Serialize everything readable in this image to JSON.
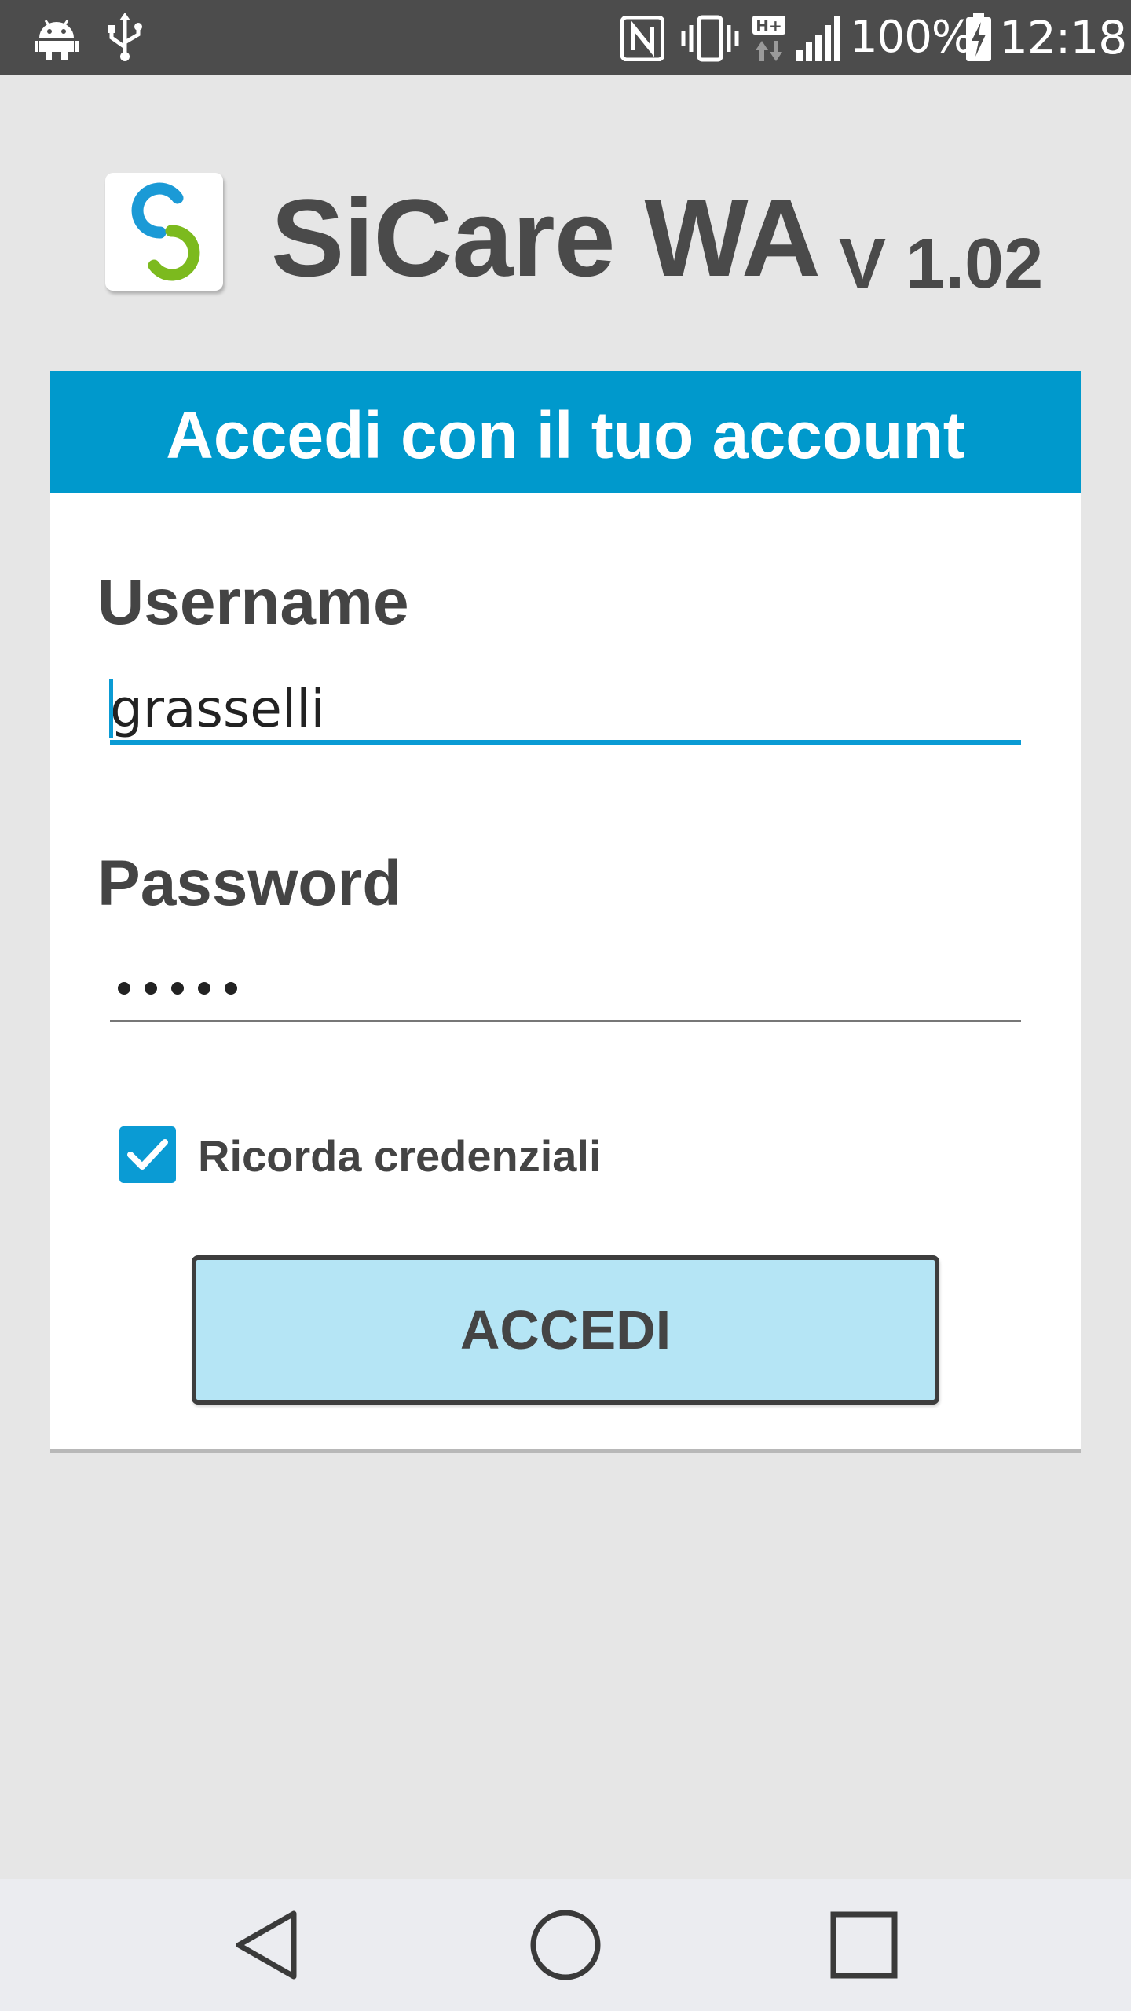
{
  "status_bar": {
    "left_icons": [
      "android-debug-icon",
      "usb-icon"
    ],
    "right_icons": [
      "nfc-icon",
      "vibrate-icon",
      "hplus-data-icon",
      "signal-icon",
      "battery-charging-icon"
    ],
    "battery_percent": "100%",
    "time": "12:18"
  },
  "header": {
    "logo_icon": "sicare-logo-icon",
    "title": "SiCare WA",
    "version": "V 1.02"
  },
  "login": {
    "heading": "Accedi con il tuo account",
    "username_label": "Username",
    "username_value": "grasselli",
    "password_label": "Password",
    "password_length": 5,
    "remember_label": "Ricorda credenziali",
    "remember_checked": true,
    "submit_label": "ACCEDI"
  },
  "colors": {
    "accent": "#0099cc",
    "button_fill": "#b5e5f5",
    "background": "#e6e6e6",
    "status_bar": "#4c4c4c"
  },
  "nav_bar": {
    "buttons": [
      "back-icon",
      "home-icon",
      "recents-icon"
    ]
  }
}
